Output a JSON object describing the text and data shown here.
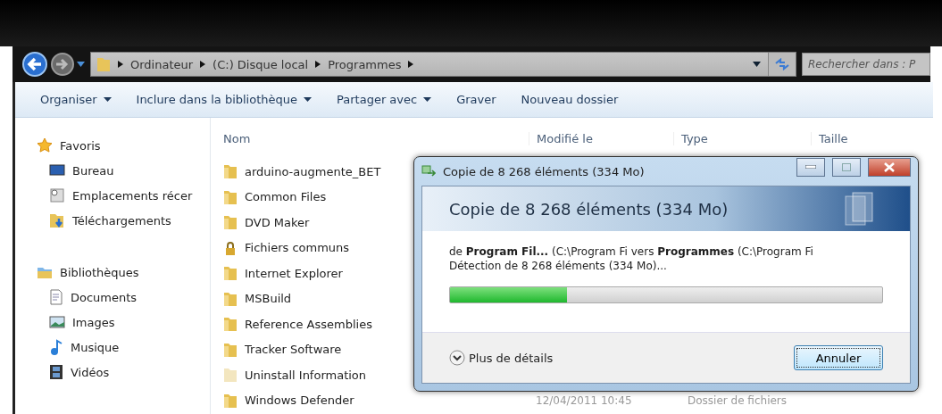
{
  "nav": {
    "breadcrumb": [
      "Ordinateur",
      "(C:) Disque local",
      "Programmes"
    ],
    "search": {
      "placeholder": "Rechercher dans : P"
    }
  },
  "toolbar": [
    {
      "label": "Organiser",
      "dropdown": true
    },
    {
      "label": "Inclure dans la bibliothèque",
      "dropdown": true
    },
    {
      "label": "Partager avec",
      "dropdown": true
    },
    {
      "label": "Graver",
      "dropdown": false
    },
    {
      "label": "Nouveau dossier",
      "dropdown": false
    }
  ],
  "sidebar": {
    "groups": [
      {
        "label": "Favoris",
        "kind": "star",
        "items": [
          {
            "label": "Bureau",
            "kind": "desktop"
          },
          {
            "label": "Emplacements récer",
            "kind": "recent"
          },
          {
            "label": "Téléchargements",
            "kind": "download"
          }
        ]
      },
      {
        "label": "Bibliothèques",
        "kind": "library",
        "items": [
          {
            "label": "Documents",
            "kind": "document"
          },
          {
            "label": "Images",
            "kind": "image"
          },
          {
            "label": "Musique",
            "kind": "music"
          },
          {
            "label": "Vidéos",
            "kind": "video"
          }
        ]
      }
    ]
  },
  "file_list": {
    "columns": [
      "Nom",
      "Modifié le",
      "Type",
      "Taille"
    ],
    "rows": [
      {
        "name": "arduino-augmente_BET",
        "kind": "folder"
      },
      {
        "name": "Common Files",
        "kind": "folder"
      },
      {
        "name": "DVD Maker",
        "kind": "folder"
      },
      {
        "name": "Fichiers communs",
        "kind": "locked"
      },
      {
        "name": "Internet Explorer",
        "kind": "folder"
      },
      {
        "name": "MSBuild",
        "kind": "folder"
      },
      {
        "name": "Reference Assemblies",
        "kind": "folder"
      },
      {
        "name": "Tracker Software",
        "kind": "folder"
      },
      {
        "name": "Uninstall Information",
        "kind": "hidden"
      },
      {
        "name": "Windows Defender",
        "kind": "folder",
        "modified": "12/04/2011 10:45",
        "type": "Dossier de fichiers"
      }
    ]
  },
  "dialog": {
    "title": "Copie de 8 268 éléments (334 Mo)",
    "heading": "Copie de 8 268 éléments (334 Mo)",
    "source": "de **Program Fil...**  (C:\\Program Fi vers **Programmes** (C:\\Program Fi",
    "status": "Détection de 8 268 éléments (334 Mo)...",
    "level": 0.27,
    "details": "Plus de détails",
    "cancel": "Annuler"
  }
}
